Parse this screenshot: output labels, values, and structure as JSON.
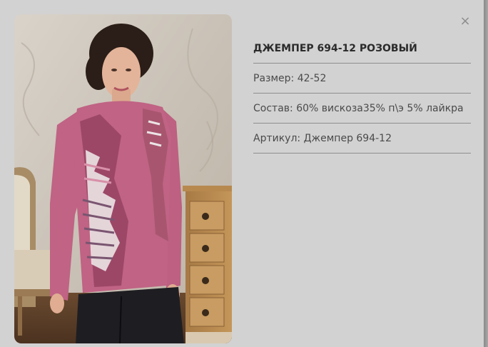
{
  "modal": {
    "close_symbol": "×",
    "product": {
      "title": "ДЖЕМПЕР 694-12 РОЗОВЫЙ",
      "size": "Размер: 42-52",
      "composition": "Состав: 60% вискоза35% п\\э 5% лайкра",
      "article": "Артикул: Джемпер 694-12"
    },
    "colors": {
      "modal_bg": "#d2d2d2",
      "garment_pink": "#c06384",
      "skirt_black": "#1e1e22",
      "divider": "#8e8e8e"
    }
  }
}
